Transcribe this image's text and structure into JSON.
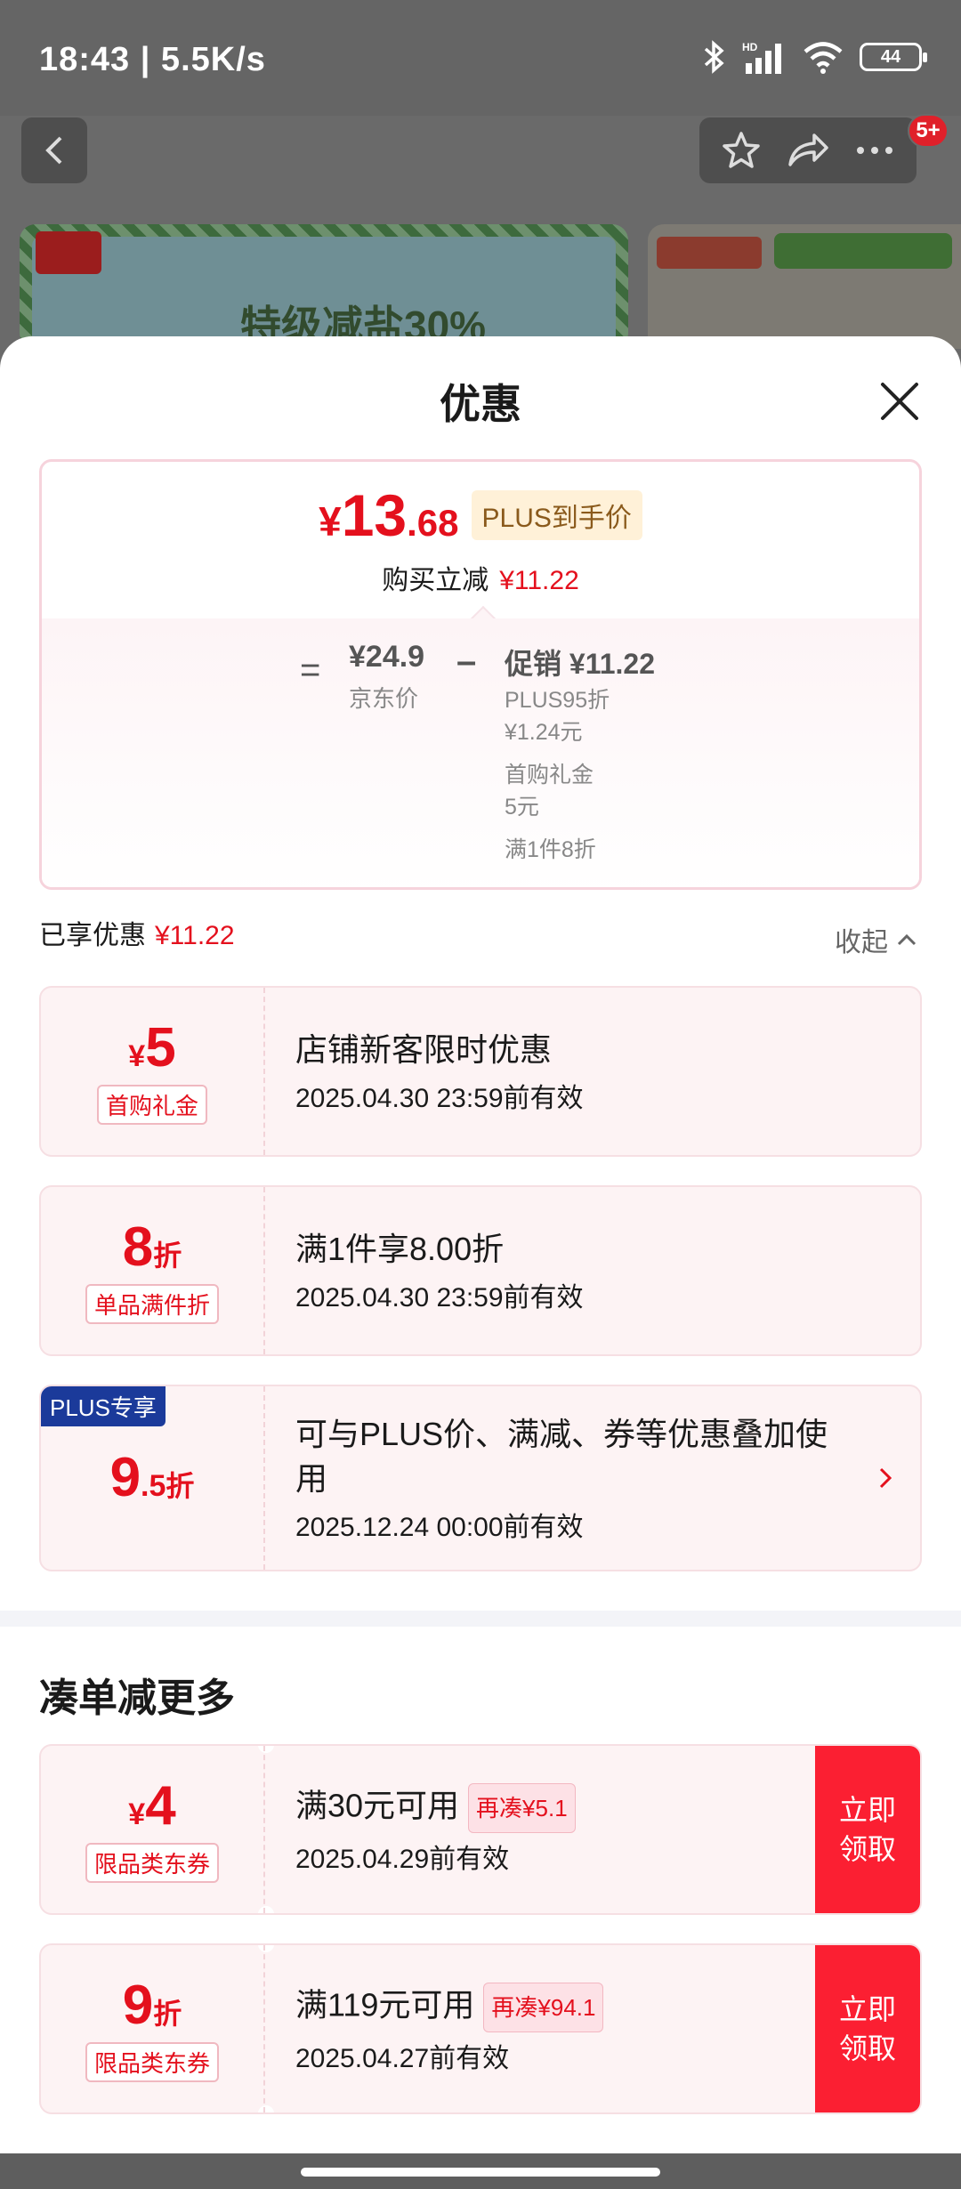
{
  "status_bar": {
    "time": "18:43 | 5.5K/s",
    "battery": "44"
  },
  "background": {
    "badge": "5+",
    "banner_text": "特级减盐30%"
  },
  "sheet": {
    "title": "优惠"
  },
  "price_card": {
    "currency": "¥",
    "price_int": "13",
    "price_dec": ".68",
    "plus_tag": "PLUS到手价",
    "saved_label": "购买立减",
    "saved_value": "¥11.22",
    "eq": "=",
    "jd_price": "¥24.9",
    "jd_label": "京东价",
    "minus": "–",
    "promo_label": "促销",
    "promo_value": "¥11.22",
    "promo_line1": "PLUS95折",
    "promo_line2": "¥1.24元",
    "promo_line3": "首购礼金",
    "promo_line4": "5元",
    "promo_line5": "满1件8折"
  },
  "enjoyed": {
    "label": "已享优惠",
    "value": "¥11.22",
    "collapse": "收起"
  },
  "applied_coupons": [
    {
      "cur": "¥",
      "num": "5",
      "suffix": "",
      "kind": "首购礼金",
      "desc": "店铺新客限时优惠",
      "valid": "2025.04.30 23:59前有效"
    },
    {
      "cur": "",
      "num": "8",
      "suffix": "折",
      "kind": "单品满件折",
      "desc": "满1件享8.00折",
      "valid": "2025.04.30 23:59前有效"
    },
    {
      "badge": "PLUS专享",
      "num": "9",
      "decimal": ".5",
      "suffix": "折",
      "desc": "可与PLUS价、满减、券等优惠叠加使用",
      "valid": "2025.12.24 00:00前有效"
    }
  ],
  "more_section": {
    "title": "凑单减更多"
  },
  "more_coupons": [
    {
      "cur": "¥",
      "num": "4",
      "suffix": "",
      "kind": "限品类东券",
      "desc": "满30元可用",
      "tag": "再凑¥5.1",
      "valid": "2025.04.29前有效",
      "button": "立即领取"
    },
    {
      "cur": "",
      "num": "9",
      "suffix": "折",
      "kind": "限品类东券",
      "desc": "满119元可用",
      "tag": "再凑¥94.1",
      "valid": "2025.04.27前有效",
      "button": "立即领取"
    }
  ],
  "icons": {
    "back": "chevron-left-icon",
    "favorite": "star-icon",
    "share": "share-icon",
    "more": "more-icon",
    "close": "close-icon",
    "collapse": "chevron-up-icon",
    "go": "chevron-right-icon"
  },
  "colors": {
    "accent_red": "#e4101d",
    "button_red": "#fb1f32",
    "plus_blue": "#1b3a9a",
    "plus_gold_bg": "#fff1d8"
  }
}
